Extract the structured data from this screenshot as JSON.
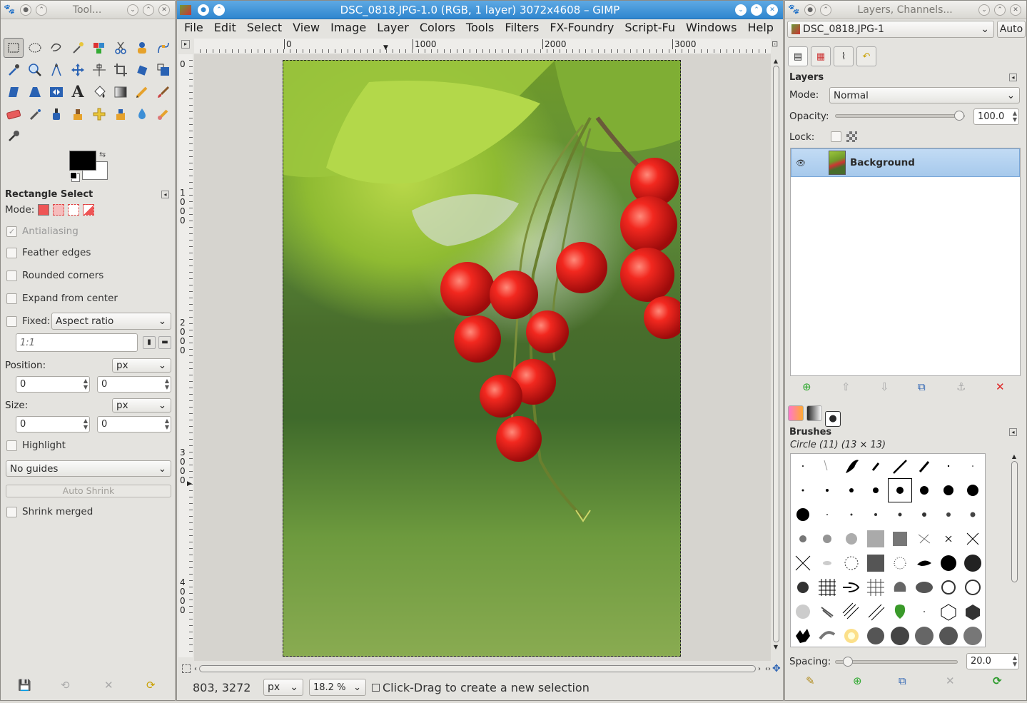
{
  "toolbox": {
    "title": "Tool...",
    "tool_options_title": "Rectangle Select",
    "mode_label": "Mode:",
    "antialiasing": "Antialiasing",
    "feather": "Feather edges",
    "rounded": "Rounded corners",
    "expand": "Expand from center",
    "fixed_label": "Fixed:",
    "fixed_value": "Aspect ratio",
    "ratio_value": "1:1",
    "position_label": "Position:",
    "position_unit": "px",
    "pos_x": "0",
    "pos_y": "0",
    "size_label": "Size:",
    "size_unit": "px",
    "size_w": "0",
    "size_h": "0",
    "highlight": "Highlight",
    "guides": "No guides",
    "auto_shrink": "Auto Shrink",
    "shrink_merged": "Shrink merged"
  },
  "image_window": {
    "title": "DSC_0818.JPG-1.0 (RGB, 1 layer) 3072x4608 – GIMP",
    "menu": [
      "File",
      "Edit",
      "Select",
      "View",
      "Image",
      "Layer",
      "Colors",
      "Tools",
      "Filters",
      "FX-Foundry",
      "Script-Fu",
      "Windows",
      "Help"
    ],
    "hruler": [
      "0",
      "1000",
      "2000",
      "3000"
    ],
    "vruler": [
      "0",
      "1\n0\n0\n0",
      "2\n0\n0\n0",
      "3\n0\n0\n0",
      "4\n0\n0\n0"
    ],
    "coords": "803, 3272",
    "unit": "px",
    "zoom": "18.2 %",
    "status": "Click-Drag to create a new selection"
  },
  "dock": {
    "title": "Layers, Channels...",
    "image_select": "DSC_0818.JPG-1",
    "auto_label": "Auto",
    "layers_title": "Layers",
    "mode_label": "Mode:",
    "mode_value": "Normal",
    "opacity_label": "Opacity:",
    "opacity_value": "100.0",
    "lock_label": "Lock:",
    "layer_name": "Background",
    "brushes_title": "Brushes",
    "brush_name": "Circle (11) (13 × 13)",
    "spacing_label": "Spacing:",
    "spacing_value": "20.0"
  }
}
